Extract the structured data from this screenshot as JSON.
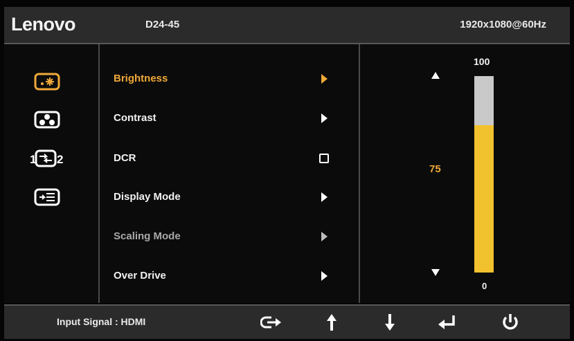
{
  "header": {
    "brand": "Lenovo",
    "model": "D24-45",
    "resolution": "1920x1080@60Hz"
  },
  "categories": [
    {
      "icon": "brightness-contrast-icon",
      "active": true
    },
    {
      "icon": "color-icon",
      "active": false
    },
    {
      "icon": "input-source-icon",
      "active": false
    },
    {
      "icon": "menu-settings-icon",
      "active": false
    }
  ],
  "menu": {
    "items": [
      {
        "label": "Brightness",
        "control": "arrow",
        "state": "active"
      },
      {
        "label": "Contrast",
        "control": "arrow",
        "state": "normal"
      },
      {
        "label": "DCR",
        "control": "checkbox",
        "state": "normal"
      },
      {
        "label": "Display Mode",
        "control": "arrow",
        "state": "normal"
      },
      {
        "label": "Scaling Mode",
        "control": "arrow",
        "state": "disabled"
      },
      {
        "label": "Over Drive",
        "control": "arrow",
        "state": "normal"
      }
    ]
  },
  "slider": {
    "max": "100",
    "min": "0",
    "value": "75",
    "fill_fraction": 0.75
  },
  "footer": {
    "input_signal": "Input Signal : HDMI",
    "buttons": [
      "exit-icon",
      "up-icon",
      "down-icon",
      "enter-icon",
      "power-icon"
    ]
  },
  "colors": {
    "accent": "#f0a93a",
    "slider_fill": "#f2c12e",
    "slider_track": "#c9c9c9",
    "bar_bg": "#2b2b2b"
  }
}
